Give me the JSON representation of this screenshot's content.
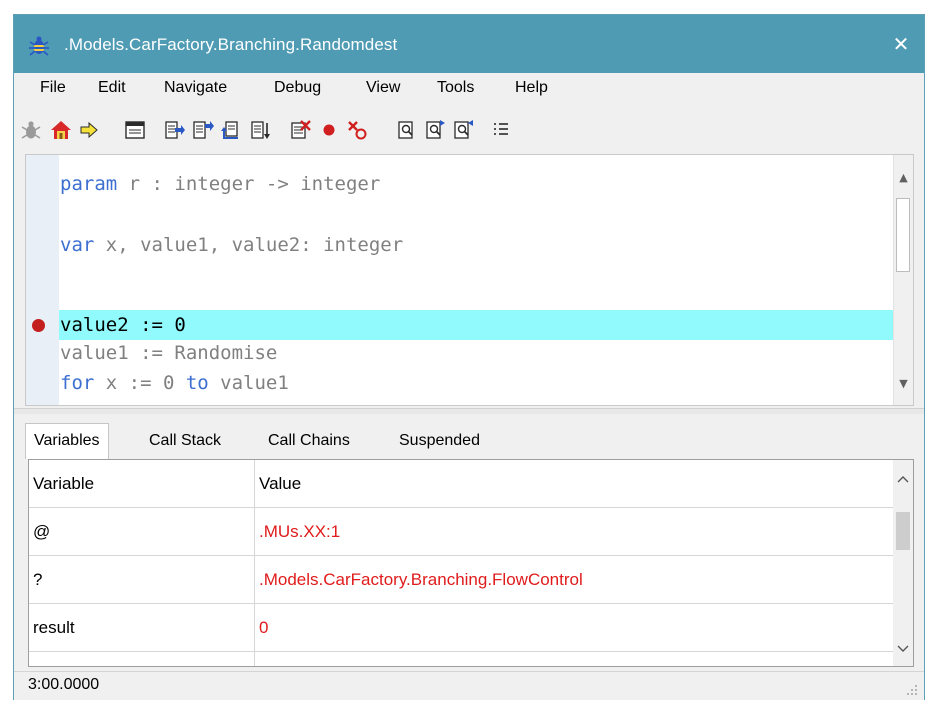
{
  "window": {
    "title": ".Models.CarFactory.Branching.Randomdest",
    "close_glyph": "✕"
  },
  "menu": [
    "File",
    "Edit",
    "Navigate",
    "Debug",
    "View",
    "Tools",
    "Help"
  ],
  "toolbar_icons": [
    "bug-icon",
    "home-icon",
    "arrow-right-icon",
    "window-icon",
    "step-into-icon",
    "step-over-icon",
    "step-back-icon",
    "step-out-icon",
    "clear-breakpoints-icon",
    "breakpoint-icon",
    "remove-breakpoint-icon",
    "find-icon",
    "find-next-icon",
    "find-prev-icon",
    "list-icon"
  ],
  "editor": {
    "lines": [
      {
        "kw": "param",
        "rest": " r : integer -> integer"
      },
      {
        "kw": "",
        "rest": ""
      },
      {
        "kw": "var",
        "rest": " x, value1, value2: integer"
      },
      {
        "kw": "",
        "rest": ""
      },
      {
        "kw": "",
        "rest": "value2 := 0"
      },
      {
        "kw": "",
        "rest": "value1 := Randomise"
      },
      {
        "kw": "for",
        "rest": " x := 0 ",
        "kw2": "to",
        "rest2": " value1"
      }
    ],
    "current_line": "value2 := 0"
  },
  "tabs": [
    "Variables",
    "Call Stack",
    "Call Chains",
    "Suspended"
  ],
  "variables": {
    "headers": [
      "Variable",
      "Value"
    ],
    "rows": [
      {
        "name": "@",
        "value": ".MUs.XX:1"
      },
      {
        "name": "?",
        "value": ".Models.CarFactory.Branching.FlowControl"
      },
      {
        "name": "result",
        "value": "0"
      }
    ]
  },
  "status": {
    "time": "3:00.0000"
  },
  "colors": {
    "titlebar": "#4f9bb4",
    "highlight": "#90fafc",
    "value_text": "#e01b1b",
    "keyword": "#3c6fd0",
    "breakpoint": "#c41f1f"
  }
}
